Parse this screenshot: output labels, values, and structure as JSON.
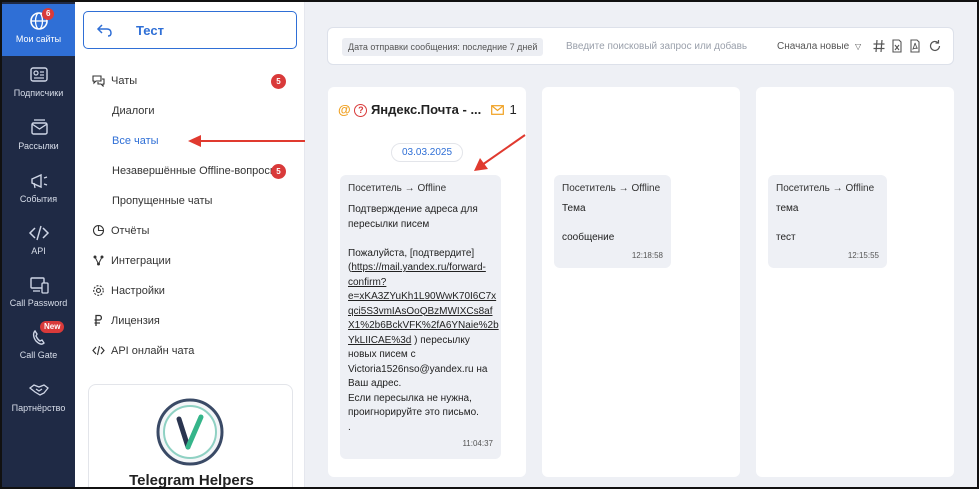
{
  "rail": {
    "items": [
      {
        "label": "Мои сайты",
        "badge": "6"
      },
      {
        "label": "Подписчики"
      },
      {
        "label": "Рассылки"
      },
      {
        "label": "События"
      },
      {
        "label": "API"
      },
      {
        "label": "Call Password"
      },
      {
        "label": "Call Gate",
        "badge": "New"
      },
      {
        "label": "Партнёрство"
      }
    ]
  },
  "sidebar": {
    "project_title": "Тест",
    "menu": [
      {
        "label": "Чаты",
        "badge": "5"
      },
      {
        "label": "Диалоги"
      },
      {
        "label": "Все чаты"
      },
      {
        "label": "Незавершённые Offline-вопросы",
        "badge": "5"
      },
      {
        "label": "Пропущенные чаты"
      },
      {
        "label": "Отчёты"
      },
      {
        "label": "Интеграции"
      },
      {
        "label": "Настройки"
      },
      {
        "label": "Лицензия"
      },
      {
        "label": "API онлайн чата"
      }
    ],
    "promo_title": "Telegram Helpers"
  },
  "toolbar": {
    "filter_chip": "Дата отправки сообщения: последние 7 дней",
    "search_placeholder": "Введите поисковый запрос или добавь",
    "sort_label": "Сначала новые"
  },
  "columns": [
    {
      "header": "Яндекс.Почта - ...",
      "count": "1",
      "date": "03.03.2025",
      "message": {
        "from": "Посетитель → Offline",
        "body_before": "Подтверждение адреса для\nпересылки писем\n\nПожалуйста, [подтвердите](",
        "link": "https://mail.yandex.ru/forward-\nconfirm?\ne=xKA3ZYuKh1L90WwK70I6C7x\nqci5S3vmIAsOoQBzMWIXCs8af\nX1%2b6BckVFK%2fA6YNaie%2b\nYkLIICAE%3d",
        "body_after": " ) пересылку\nновых писем с\nVictoria1526nso@yandex.ru на\nВаш адрес.\nЕсли пересылка не нужна,\nпроигнорируйте это письмо.\n.",
        "time": "11:04:37"
      }
    },
    {
      "message": {
        "from": "Посетитель → Offline",
        "body": "Тема\n\nсообщение",
        "time": "12:18:58"
      }
    },
    {
      "message": {
        "from": "Посетитель → Offline",
        "body": "тема\n\nтест",
        "time": "12:15:55"
      }
    }
  ],
  "colors": {
    "accent": "#2f6fd6",
    "rail_bg": "#1f2a45",
    "badge": "#d93a3a",
    "arrow": "#e03a2f"
  }
}
